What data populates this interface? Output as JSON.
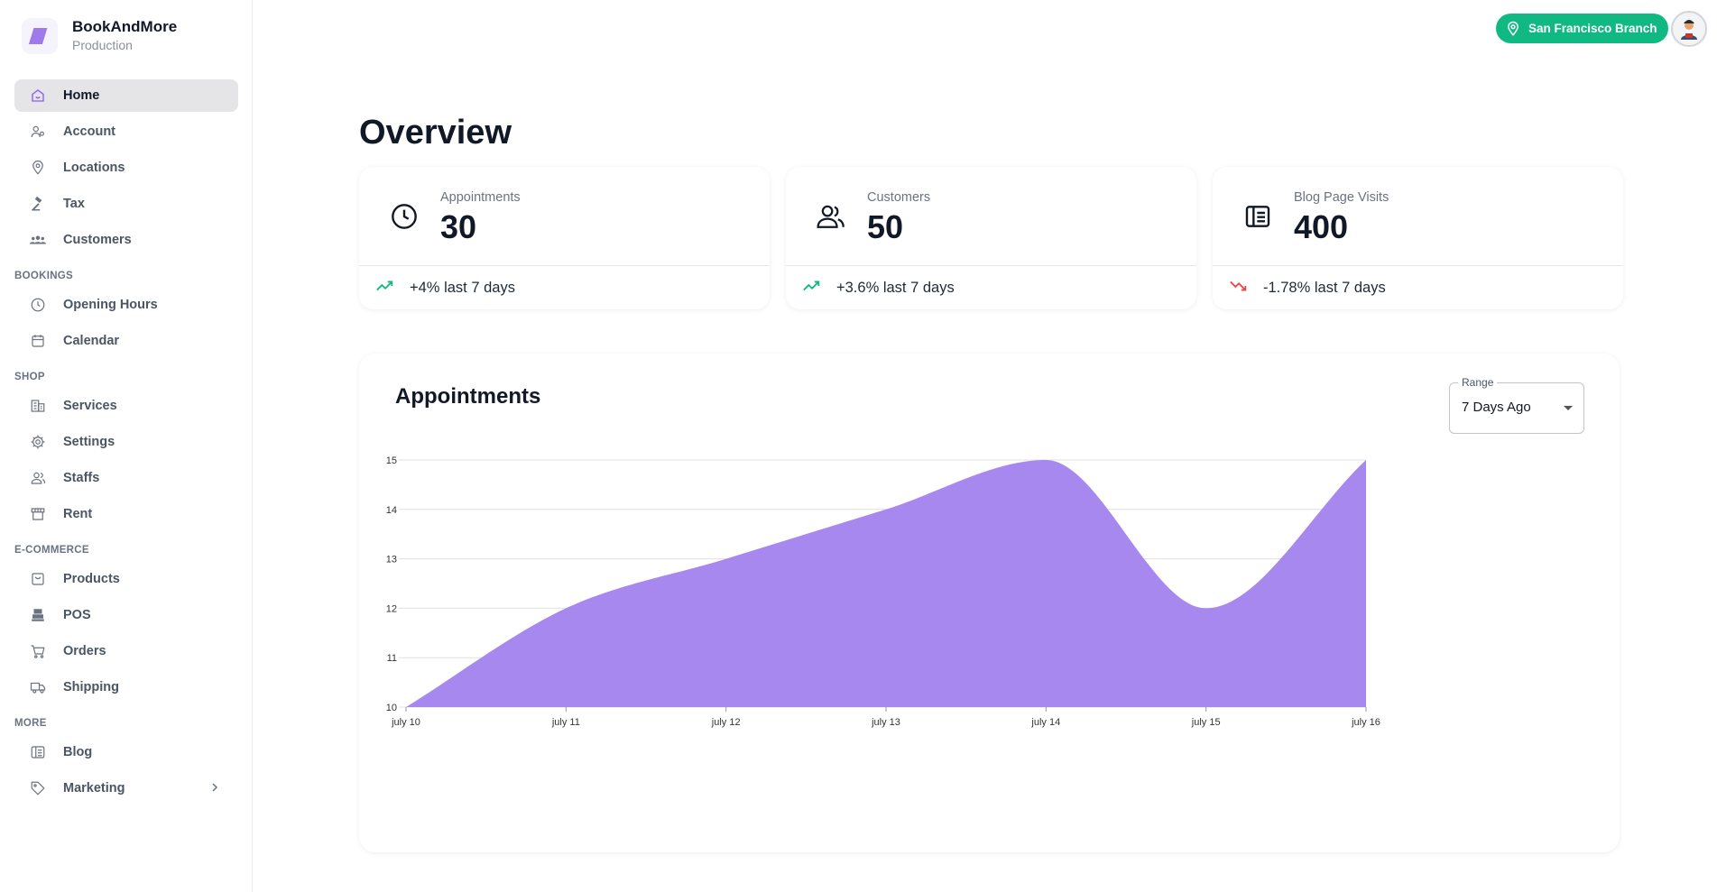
{
  "app": {
    "name": "BookAndMore",
    "environment": "Production"
  },
  "sidebar": {
    "items_top": [
      {
        "label": "Home",
        "icon": "home-icon",
        "active": true
      },
      {
        "label": "Account",
        "icon": "account-icon"
      },
      {
        "label": "Locations",
        "icon": "location-pin-icon"
      },
      {
        "label": "Tax",
        "icon": "gavel-icon"
      },
      {
        "label": "Customers",
        "icon": "customers-icon"
      }
    ],
    "sections": [
      {
        "title": "BOOKINGS",
        "items": [
          {
            "label": "Opening Hours",
            "icon": "clock-icon"
          },
          {
            "label": "Calendar",
            "icon": "calendar-icon"
          }
        ]
      },
      {
        "title": "SHOP",
        "items": [
          {
            "label": "Services",
            "icon": "services-icon"
          },
          {
            "label": "Settings",
            "icon": "gear-icon"
          },
          {
            "label": "Staffs",
            "icon": "staffs-icon"
          },
          {
            "label": "Rent",
            "icon": "storefront-icon"
          }
        ]
      },
      {
        "title": "E-COMMERCE",
        "items": [
          {
            "label": "Products",
            "icon": "product-box-icon"
          },
          {
            "label": "POS",
            "icon": "pos-icon"
          },
          {
            "label": "Orders",
            "icon": "cart-icon"
          },
          {
            "label": "Shipping",
            "icon": "truck-icon"
          }
        ]
      },
      {
        "title": "MORE",
        "items": [
          {
            "label": "Blog",
            "icon": "blog-icon"
          },
          {
            "label": "Marketing",
            "icon": "tag-icon",
            "has_submenu": true
          }
        ]
      }
    ]
  },
  "header": {
    "branch_label": "San Francisco Branch",
    "branch_color": "#10b981"
  },
  "main": {
    "title": "Overview",
    "stats": [
      {
        "label": "Appointments",
        "value": "30",
        "change": "+4% last 7 days",
        "trend": "up",
        "icon": "clock-icon"
      },
      {
        "label": "Customers",
        "value": "50",
        "change": "+3.6% last 7 days",
        "trend": "up",
        "icon": "customers-icon"
      },
      {
        "label": "Blog Page Visits",
        "value": "400",
        "change": "-1.78% last 7 days",
        "trend": "down",
        "icon": "blog-icon"
      }
    ],
    "trend_colors": {
      "up": "#10b981",
      "down": "#ef4444"
    },
    "chart_card": {
      "title": "Appointments",
      "range_label": "Range",
      "range_value": "7 Days Ago"
    }
  },
  "chart_data": {
    "type": "area",
    "x": [
      "july 10",
      "july 11",
      "july 12",
      "july 13",
      "july 14",
      "july 15",
      "july 16"
    ],
    "series": [
      {
        "values": [
          10,
          12,
          13,
          14,
          15,
          12,
          15
        ]
      }
    ],
    "yticks": [
      10,
      11,
      12,
      13,
      14,
      15
    ],
    "ylim": [
      10,
      15
    ],
    "grid": true,
    "color": "#a282ee",
    "title": "",
    "xlabel": "",
    "ylabel": ""
  }
}
